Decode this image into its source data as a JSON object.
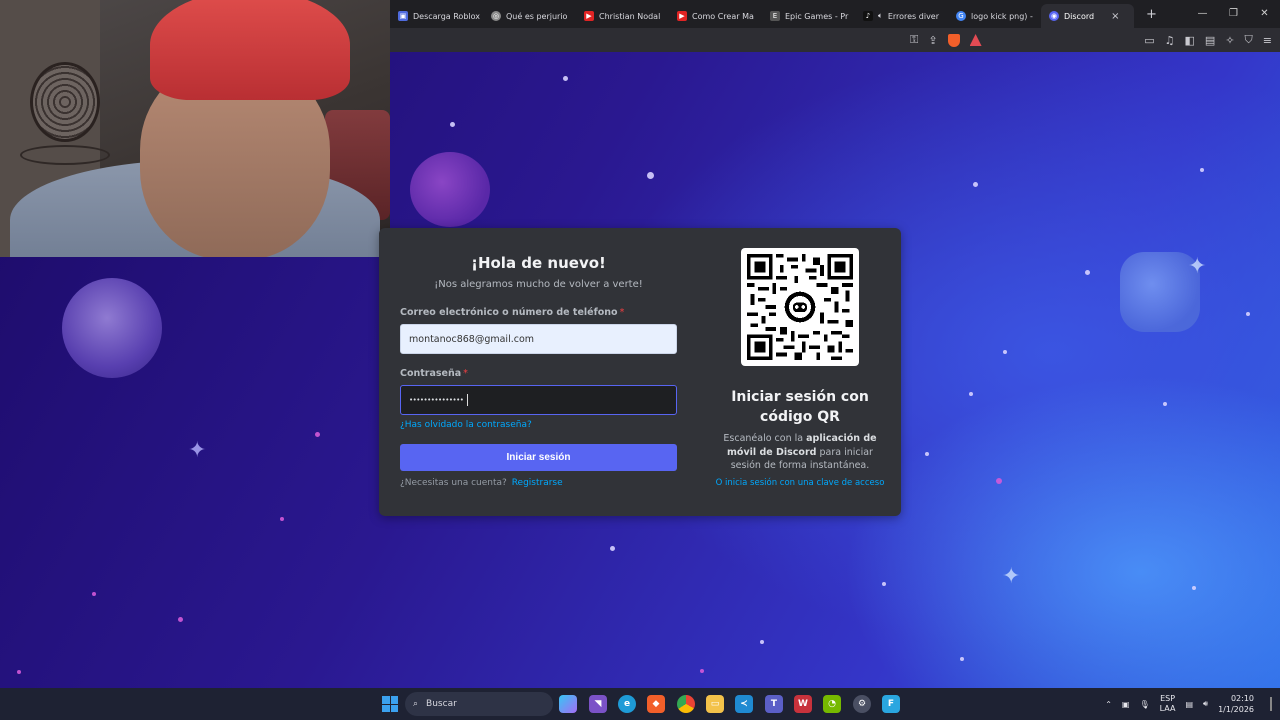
{
  "browser": {
    "tabs": [
      {
        "label": "Descarga Roblox",
        "color": "#4f6bde",
        "active": false
      },
      {
        "label": "Qué es perjurio",
        "color": "#8a8a8a",
        "active": false
      },
      {
        "label": "Christian Nodal",
        "color": "#e02424",
        "active": false
      },
      {
        "label": "Como Crear Ma",
        "color": "#e02424",
        "active": false
      },
      {
        "label": "Epic Games - Pr",
        "color": "#555555",
        "active": false
      },
      {
        "label": "Errores diver",
        "color": "#111111",
        "active": false
      },
      {
        "label": "logo kick png) -",
        "color": "#4285f4",
        "active": false
      },
      {
        "label": "Discord",
        "color": "#5865f2",
        "active": true
      }
    ],
    "new_tab": "+",
    "close_tab": "×",
    "window_controls": [
      "—",
      "❐",
      "✕"
    ]
  },
  "login": {
    "title": "¡Hola de nuevo!",
    "subtitle": "¡Nos alegramos mucho de volver a verte!",
    "email_label": "Correo electrónico o número de teléfono",
    "required_mark": "*",
    "email_value": "montanoc868@gmail.com",
    "password_label": "Contraseña",
    "password_value": "•••••••••••••••",
    "forgot_link": "¿Has olvidado la contraseña?",
    "submit_label": "Iniciar sesión",
    "need_account": "¿Necesitas una cuenta?",
    "register_link": "Registrarse"
  },
  "qr": {
    "title_line1": "Iniciar sesión con",
    "title_line2": "código QR",
    "desc_part1": "Escanéalo con la ",
    "desc_bold": "aplicación de móvil de Discord",
    "desc_part2": " para iniciar sesión de forma instantánea.",
    "passkey_link": "O inicia sesión con una clave de acceso"
  },
  "taskbar": {
    "search_placeholder": "Buscar",
    "lang_line1": "ESP",
    "lang_line2": "LAA",
    "time": "02:10",
    "date": "1/1/2026"
  }
}
